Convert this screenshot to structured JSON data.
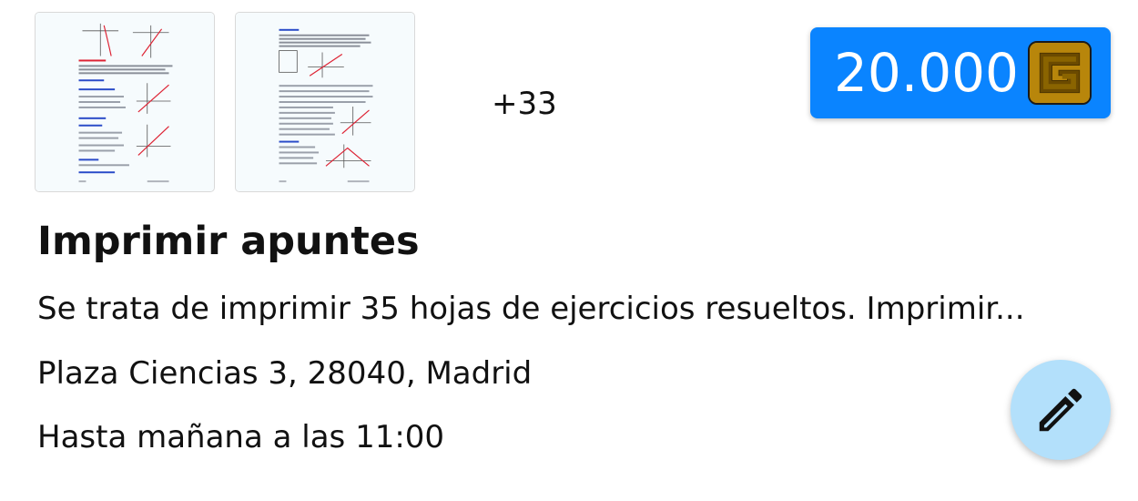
{
  "attachments": {
    "thumbnails": [
      {
        "icon": "document-page-thumbnail"
      },
      {
        "icon": "document-page-thumbnail"
      }
    ],
    "more_count": "+33"
  },
  "price": {
    "value": "20.000",
    "currency_icon": "g-coin-icon",
    "badge_color": "#0a84ff",
    "coin_color": "#b8860b"
  },
  "task": {
    "title": "Imprimir apuntes",
    "description": "Se trata de imprimir 35 hojas de ejercicios resueltos. Imprimir...",
    "address": "Plaza Ciencias 3, 28040, Madrid",
    "deadline": "Hasta mañana a las 11:00"
  },
  "actions": {
    "edit_icon": "pencil-icon",
    "fab_color": "#b3e0fb"
  }
}
